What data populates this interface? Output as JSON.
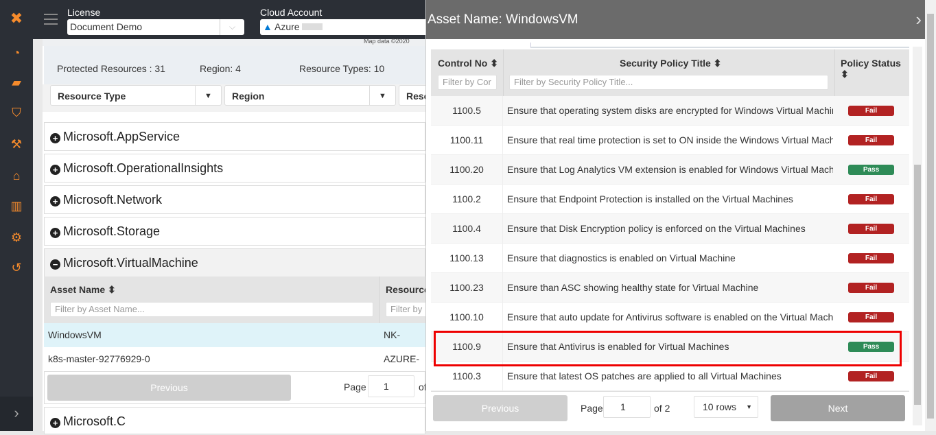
{
  "sidebar": {
    "icons": [
      "logo-icon",
      "dashboard-gauge-icon",
      "briefcase-icon",
      "shield-icon",
      "hammer-icon",
      "bank-icon",
      "bar-chart-icon",
      "gear-icon",
      "history-icon"
    ],
    "expand": "›"
  },
  "topbar": {
    "license_label": "License",
    "license_value": "Document Demo",
    "cloud_label": "Cloud Account",
    "cloud_value": "Azure"
  },
  "main": {
    "map_credit": "Map data ©2020",
    "stats": {
      "protected": "Protected Resources : 31",
      "region": "Region: 4",
      "types": "Resource Types: 10"
    },
    "filters": [
      "Resource Type",
      "Region",
      "Reso"
    ],
    "groups": [
      {
        "name": "Microsoft.AppService",
        "expanded": false
      },
      {
        "name": "Microsoft.OperationalInsights",
        "expanded": false
      },
      {
        "name": "Microsoft.Network",
        "expanded": false
      },
      {
        "name": "Microsoft.Storage",
        "expanded": false
      },
      {
        "name": "Microsoft.VirtualMachine",
        "expanded": true
      },
      {
        "name": "Microsoft.C",
        "expanded": false
      }
    ],
    "assets_table": {
      "col_asset": "Asset Name ⬍",
      "col_resource": "Resource",
      "asset_placeholder": "Filter by Asset Name...",
      "resource_placeholder": "Filter by",
      "rows": [
        {
          "asset": "WindowsVM",
          "resource": "NK-VIRTU"
        },
        {
          "asset": "k8s-master-92776929-0",
          "resource": "AZURE-KU"
        }
      ],
      "previous": "Previous",
      "page_label": "Page",
      "page": "1",
      "of": "of"
    }
  },
  "panel": {
    "title": "Asset Name: WindowsVM",
    "close": "›",
    "columns": {
      "control": "Control No ⬍",
      "title": "Security Policy Title ⬍",
      "status": "Policy Status ⬍"
    },
    "control_placeholder": "Filter by Cor",
    "title_placeholder": "Filter by Security Policy Title...",
    "rows": [
      {
        "no": "1100.5",
        "title": "Ensure that operating system disks are encrypted for Windows Virtual Machines",
        "status": "Fail"
      },
      {
        "no": "1100.11",
        "title": "Ensure that real time protection is set to ON inside the Windows Virtual Machines",
        "status": "Fail"
      },
      {
        "no": "1100.20",
        "title": "Ensure that Log Analytics VM extension is enabled for Windows Virtual Machines",
        "status": "Pass"
      },
      {
        "no": "1100.2",
        "title": "Ensure that Endpoint Protection is installed on the Virtual Machines",
        "status": "Fail"
      },
      {
        "no": "1100.4",
        "title": "Ensure that Disk Encryption policy is enforced on the Virtual Machines",
        "status": "Fail"
      },
      {
        "no": "1100.13",
        "title": "Ensure that diagnostics is enabled on Virtual Machine",
        "status": "Fail"
      },
      {
        "no": "1100.23",
        "title": "Ensure than ASC showing healthy state for Virtual Machine",
        "status": "Fail"
      },
      {
        "no": "1100.10",
        "title": "Ensure that auto update for Antivirus software is enabled on the Virtual Machines",
        "status": "Fail"
      },
      {
        "no": "1100.9",
        "title": "Ensure that Antivirus is enabled for Virtual Machines",
        "status": "Pass",
        "highlighted": true
      },
      {
        "no": "1100.3",
        "title": "Ensure that latest OS patches are applied to all Virtual Machines",
        "status": "Fail"
      }
    ],
    "pagination": {
      "previous": "Previous",
      "page_label": "Page",
      "page": "1",
      "of": "of 2",
      "rows": "10 rows",
      "next": "Next"
    }
  },
  "colors": {
    "pass": "#2e8b57",
    "fail": "#b22222",
    "accent": "#f68b2c",
    "highlight": "#e00000"
  }
}
